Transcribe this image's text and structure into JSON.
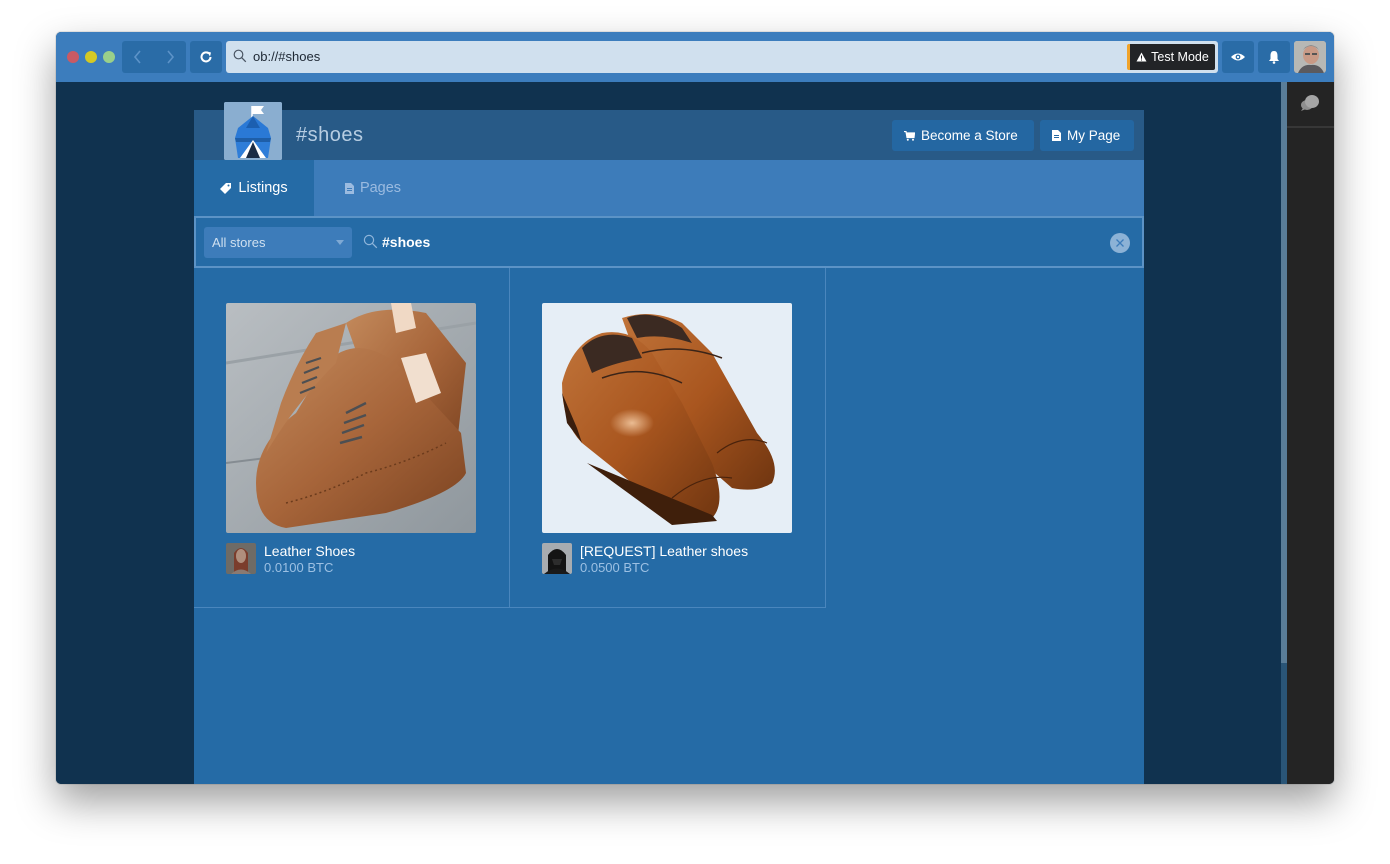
{
  "browser": {
    "url": "ob://#shoes",
    "test_mode_label": "Test Mode",
    "icons": {
      "back": "chevron-left-icon",
      "forward": "chevron-right-icon",
      "reload": "reload-icon",
      "search": "search-icon",
      "warning": "warning-icon",
      "eye": "eye-icon",
      "bell": "bell-icon",
      "chat": "chat-bubbles-icon"
    }
  },
  "page": {
    "title": "#shoes",
    "buttons": {
      "become_store": "Become a Store",
      "my_page": "My Page"
    },
    "tabs": [
      {
        "label": "Listings",
        "icon": "tag-icon",
        "active": true
      },
      {
        "label": "Pages",
        "icon": "document-icon",
        "active": false
      }
    ],
    "filter": {
      "store_select": "All stores",
      "search_value": "#shoes"
    },
    "listings": [
      {
        "title": "Leather Shoes",
        "price": "0.0100 BTC",
        "image": "brown wingtip brogue shoes on stone steps"
      },
      {
        "title": "[REQUEST] Leather shoes",
        "price": "0.0500 BTC",
        "image": "polished brown cap-toe derby shoes"
      }
    ]
  },
  "colors": {
    "titlebar": "#3c7dbd",
    "page_bg": "#256ba6",
    "header_bg": "#285a87",
    "tabbar": "#3d7cba",
    "window_bg": "#10324f",
    "test_mode_accent": "#f0a32a"
  }
}
